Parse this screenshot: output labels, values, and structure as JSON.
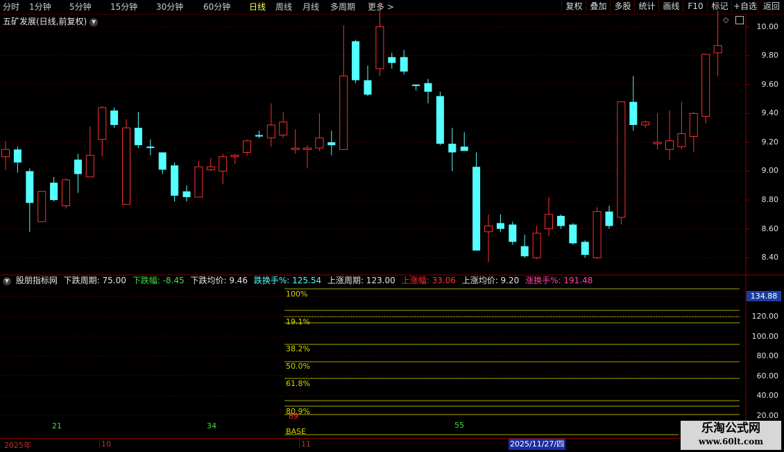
{
  "toolbar": {
    "periods": [
      "分时",
      "1分钟",
      "5分钟",
      "15分钟",
      "30分钟",
      "60分钟",
      "日线",
      "周线",
      "月线",
      "多周期",
      "更多"
    ],
    "active_period": "日线",
    "buttons": [
      "复权",
      "叠加",
      "多股",
      "统计",
      "画线",
      "F10",
      "标记",
      "+自选",
      "返回"
    ]
  },
  "stock": {
    "title": "五矿发展(日线,前复权)"
  },
  "main_axis": {
    "ticks": [
      "10.00",
      "9.80",
      "9.60",
      "9.40",
      "9.20",
      "9.00",
      "8.80",
      "8.60",
      "8.40"
    ],
    "range": [
      8.3,
      10.08
    ]
  },
  "colors": {
    "up": "#ff3030",
    "down": "#54ffff",
    "grid": "#7a0000",
    "fib_line": "#a8a800",
    "fib_text": "#d6d600"
  },
  "chart_data": {
    "type": "candlestick",
    "ohlc": [
      [
        9.1,
        9.21,
        9.01,
        9.15
      ],
      [
        9.15,
        9.17,
        8.99,
        9.06
      ],
      [
        9.0,
        9.02,
        8.58,
        8.78
      ],
      [
        8.65,
        8.86,
        8.65,
        8.86
      ],
      [
        8.92,
        8.96,
        8.79,
        8.8
      ],
      [
        8.76,
        8.95,
        8.74,
        8.94
      ],
      [
        9.08,
        9.12,
        8.85,
        8.98
      ],
      [
        8.96,
        9.31,
        8.96,
        9.11
      ],
      [
        9.22,
        9.45,
        9.1,
        9.44
      ],
      [
        9.42,
        9.44,
        9.3,
        9.32
      ],
      [
        8.77,
        9.36,
        8.77,
        9.3
      ],
      [
        9.3,
        9.41,
        9.16,
        9.18
      ],
      [
        9.17,
        9.22,
        9.11,
        9.16
      ],
      [
        9.13,
        9.13,
        8.98,
        9.01
      ],
      [
        9.04,
        9.06,
        8.79,
        8.83
      ],
      [
        8.86,
        8.9,
        8.79,
        8.82
      ],
      [
        8.82,
        9.07,
        8.82,
        9.03
      ],
      [
        9.01,
        9.09,
        9.0,
        9.03
      ],
      [
        9.0,
        9.12,
        8.91,
        9.1
      ],
      [
        9.1,
        9.12,
        9.05,
        9.11
      ],
      [
        9.13,
        9.22,
        9.11,
        9.21
      ],
      [
        9.25,
        9.28,
        9.23,
        9.24
      ],
      [
        9.23,
        9.47,
        9.17,
        9.32
      ],
      [
        9.25,
        9.41,
        9.23,
        9.34
      ],
      [
        9.15,
        9.29,
        9.12,
        9.16
      ],
      [
        9.15,
        9.18,
        9.02,
        9.16
      ],
      [
        9.16,
        9.4,
        9.14,
        9.23
      ],
      [
        9.2,
        9.28,
        9.11,
        9.18
      ],
      [
        9.15,
        10.01,
        9.15,
        9.66
      ],
      [
        9.9,
        9.91,
        9.61,
        9.63
      ],
      [
        9.63,
        9.73,
        9.52,
        9.53
      ],
      [
        9.71,
        10.17,
        9.66,
        10.0
      ],
      [
        9.79,
        9.82,
        9.71,
        9.75
      ],
      [
        9.79,
        9.84,
        9.67,
        9.69
      ],
      [
        9.6,
        9.6,
        9.56,
        9.59
      ],
      [
        9.61,
        9.64,
        9.47,
        9.55
      ],
      [
        9.52,
        9.55,
        9.18,
        9.19
      ],
      [
        9.19,
        9.3,
        9.0,
        9.13
      ],
      [
        9.17,
        9.27,
        9.14,
        9.14
      ],
      [
        9.03,
        9.13,
        8.45,
        8.45
      ],
      [
        8.58,
        8.7,
        8.37,
        8.62
      ],
      [
        8.64,
        8.7,
        8.58,
        8.6
      ],
      [
        8.63,
        8.65,
        8.49,
        8.51
      ],
      [
        8.48,
        8.56,
        8.4,
        8.41
      ],
      [
        8.4,
        8.62,
        8.39,
        8.57
      ],
      [
        8.6,
        8.82,
        8.55,
        8.7
      ],
      [
        8.69,
        8.7,
        8.6,
        8.62
      ],
      [
        8.63,
        8.64,
        8.49,
        8.5
      ],
      [
        8.51,
        8.52,
        8.4,
        8.42
      ],
      [
        8.4,
        8.75,
        8.39,
        8.72
      ],
      [
        8.72,
        8.76,
        8.6,
        8.62
      ],
      [
        8.68,
        9.48,
        8.63,
        9.48
      ],
      [
        9.48,
        9.66,
        9.28,
        9.32
      ],
      [
        9.32,
        9.35,
        9.3,
        9.34
      ],
      [
        9.19,
        9.4,
        9.15,
        9.2
      ],
      [
        9.15,
        9.42,
        9.08,
        9.21
      ],
      [
        9.17,
        9.48,
        9.15,
        9.26
      ],
      [
        9.24,
        9.41,
        9.13,
        9.4
      ],
      [
        9.38,
        9.8,
        9.33,
        9.81
      ],
      [
        9.82,
        10.11,
        9.66,
        9.87
      ]
    ]
  },
  "indicator": {
    "name": "股朋指标网",
    "items": [
      {
        "text": "下跌周期: 75.00",
        "color": "#e6e6e6"
      },
      {
        "text": "下跌幅: -8.45",
        "color": "#44dd44"
      },
      {
        "text": "下跌均价: 9.46",
        "color": "#e6e6e6"
      },
      {
        "text": "跌换手%: 125.54",
        "color": "#54ffff"
      },
      {
        "text": "上涨周期: 123.00",
        "color": "#e6e6e6"
      },
      {
        "text": "上涨幅: 33.06",
        "color": "#ff3030"
      },
      {
        "text": "上涨均价: 9.20",
        "color": "#e6e6e6"
      },
      {
        "text": "涨换手%: 191.48",
        "color": "#ff44aa"
      }
    ],
    "fib_labels": [
      "100%",
      "19.1%",
      "38.2%",
      "50.0%",
      "61.8%",
      "80.9%",
      "BASE"
    ],
    "axis_ticks": [
      "120.00",
      "100.00",
      "80.00",
      "60.00",
      "40.00",
      "20.00"
    ],
    "current_value": "134.88",
    "cycle_numbers": [
      "21",
      "34",
      "55",
      "89"
    ],
    "cycle_colors": [
      "#44dd44",
      "#44dd44",
      "#44dd44",
      "#ff3030"
    ]
  },
  "dates": {
    "labels": [
      "2025年",
      "10",
      "11"
    ],
    "cursor": "2025/11/27/四"
  },
  "watermark": {
    "brand": "乐淘公式网",
    "url": "www.60lt.com"
  }
}
